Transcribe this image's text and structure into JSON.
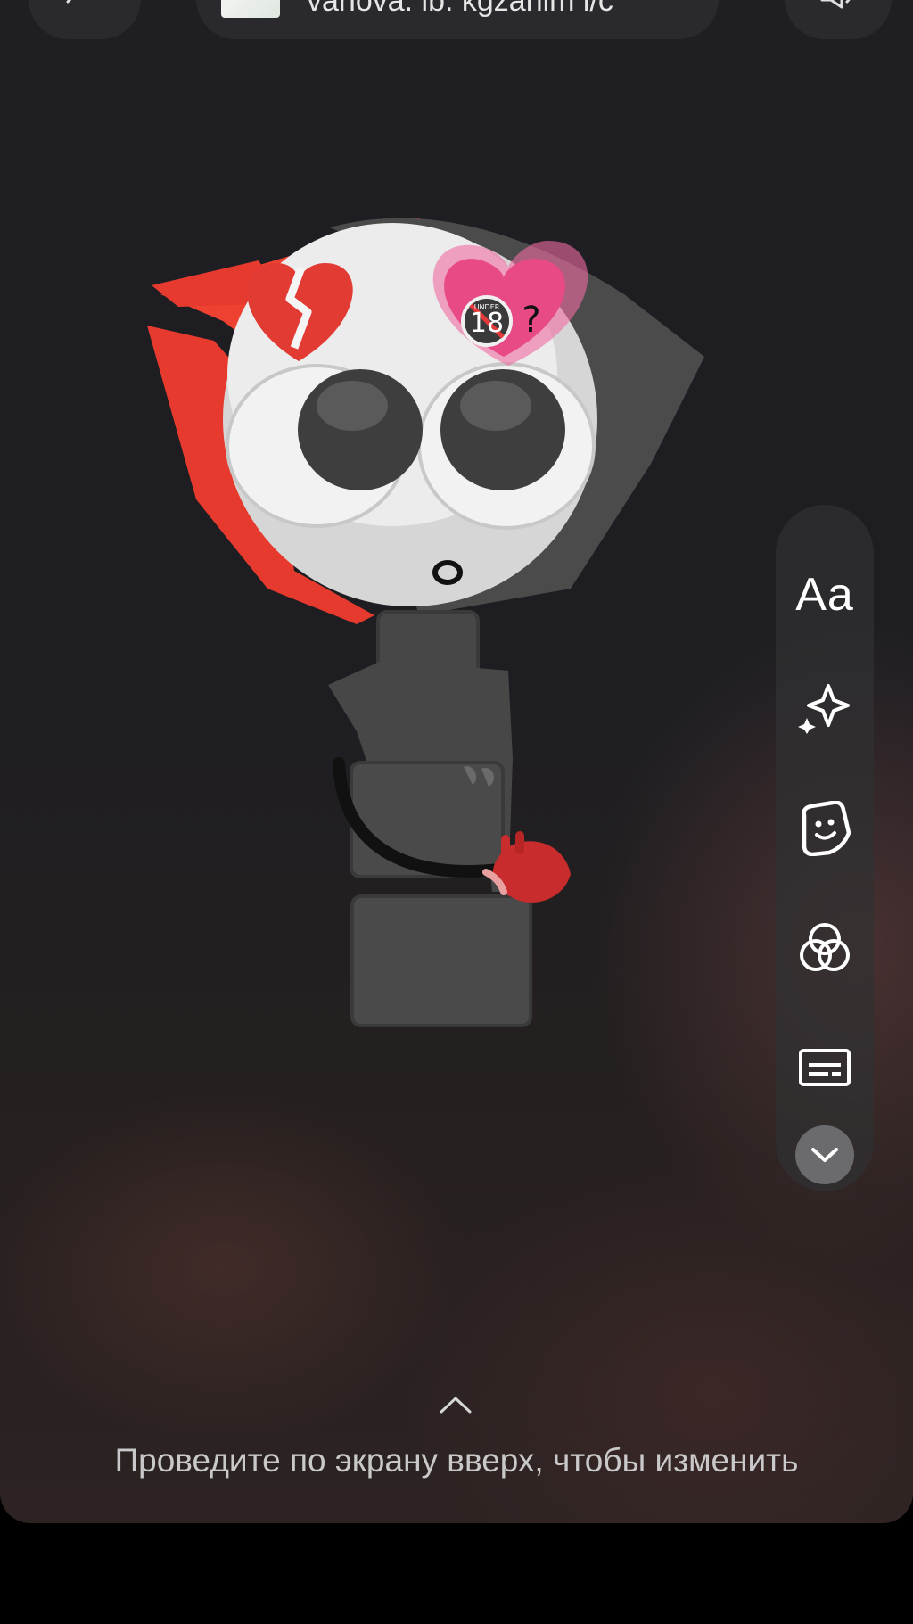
{
  "header": {
    "account_title": "vanova. ib. kgzahim i/c"
  },
  "toolbar": {
    "text_label": "Aa",
    "items": [
      {
        "icon": "text-icon"
      },
      {
        "icon": "sparkle-effects-icon"
      },
      {
        "icon": "sticker-icon"
      },
      {
        "icon": "filters-icon"
      },
      {
        "icon": "captions-icon"
      },
      {
        "icon": "chevron-down-icon"
      }
    ]
  },
  "sticker": {
    "badge_text": "18",
    "badge_small": "UNDER",
    "question_mark": "?",
    "mouth": "o"
  },
  "hint": {
    "swipe_text": "Проведите по экрану вверх, чтобы изменить"
  },
  "colors": {
    "accent_red": "#e63a2e",
    "heart_pink": "#e84a86",
    "toolbar_bg": "#303032",
    "character_body": "#474747"
  }
}
